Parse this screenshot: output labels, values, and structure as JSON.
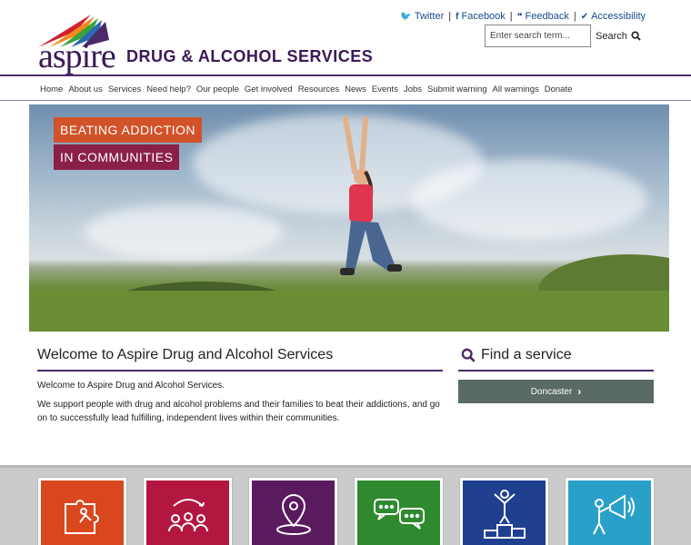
{
  "header": {
    "logo_word": "aspire",
    "logo_subtitle": "DRUG & ALCOHOL SERVICES",
    "top_links": [
      {
        "label": "Twitter",
        "icon": "twitter-icon"
      },
      {
        "label": "Facebook",
        "icon": "facebook-icon"
      },
      {
        "label": "Feedback",
        "icon": "quote-icon"
      },
      {
        "label": "Accessibility",
        "icon": "check-icon"
      }
    ],
    "search": {
      "placeholder": "Enter search term...",
      "button_label": "Search"
    }
  },
  "nav": {
    "items": [
      "Home",
      "About us",
      "Services",
      "Need help?",
      "Our people",
      "Get involved",
      "Resources",
      "News",
      "Events",
      "Jobs",
      "Submit warning",
      "All warnings",
      "Donate"
    ]
  },
  "hero": {
    "tagline_line1": "BEATING ADDICTION",
    "tagline_line2": "IN COMMUNITIES"
  },
  "welcome": {
    "title": "Welcome to Aspire Drug and Alcohol Services",
    "para1": "Welcome to Aspire Drug and Alcohol Services.",
    "para2": "We support people with drug and alcohol problems and their families to beat their addictions, and go on to successfully lead fulfilling, independent lives within their communities."
  },
  "find_service": {
    "title": "Find a service",
    "button_label": "Doncaster"
  },
  "tiles": [
    {
      "icon": "puzzle-person-icon",
      "color": "#d9471e"
    },
    {
      "icon": "people-cycle-icon",
      "color": "#b3173f"
    },
    {
      "icon": "location-pin-icon",
      "color": "#5a1a5e"
    },
    {
      "icon": "chat-bubbles-icon",
      "color": "#2f8a2f"
    },
    {
      "icon": "podium-person-icon",
      "color": "#1f3f8f"
    },
    {
      "icon": "megaphone-person-icon",
      "color": "#2aa0c9"
    }
  ],
  "colors": {
    "brand_purple": "#4b2a6a",
    "link_blue": "#1a4a8a"
  }
}
